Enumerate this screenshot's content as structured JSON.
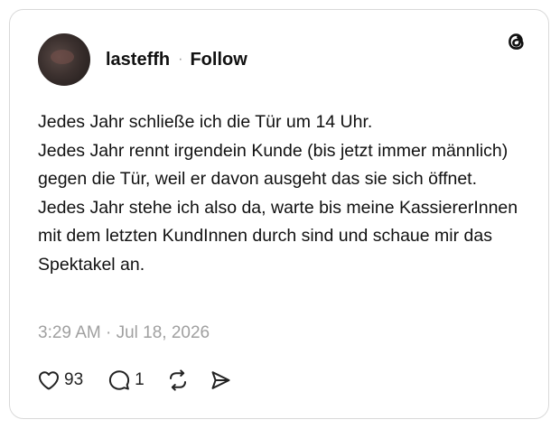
{
  "post": {
    "username": "lasteffh",
    "separator": "·",
    "follow_label": "Follow",
    "paragraphs": [
      "Jedes Jahr schließe ich die Tür um 14 Uhr.",
      "Jedes Jahr rennt irgendein Kunde (bis jetzt immer männlich) gegen die Tür, weil er davon ausgeht das sie sich öffnet.",
      "Jedes Jahr stehe ich also da, warte bis meine KassiererInnen mit dem letzten KundInnen durch sind und schaue mir das Spektakel an."
    ],
    "timestamp": "3:29 AM · Jul 18, 2026",
    "likes": "93",
    "replies": "1"
  },
  "icons": {
    "logo": "threads-logo-icon",
    "like": "heart-icon",
    "reply": "comment-bubble-icon",
    "repost": "repost-icon",
    "share": "send-icon"
  },
  "colors": {
    "text": "#111111",
    "muted": "#a0a0a0",
    "border": "#d9d9d9"
  }
}
